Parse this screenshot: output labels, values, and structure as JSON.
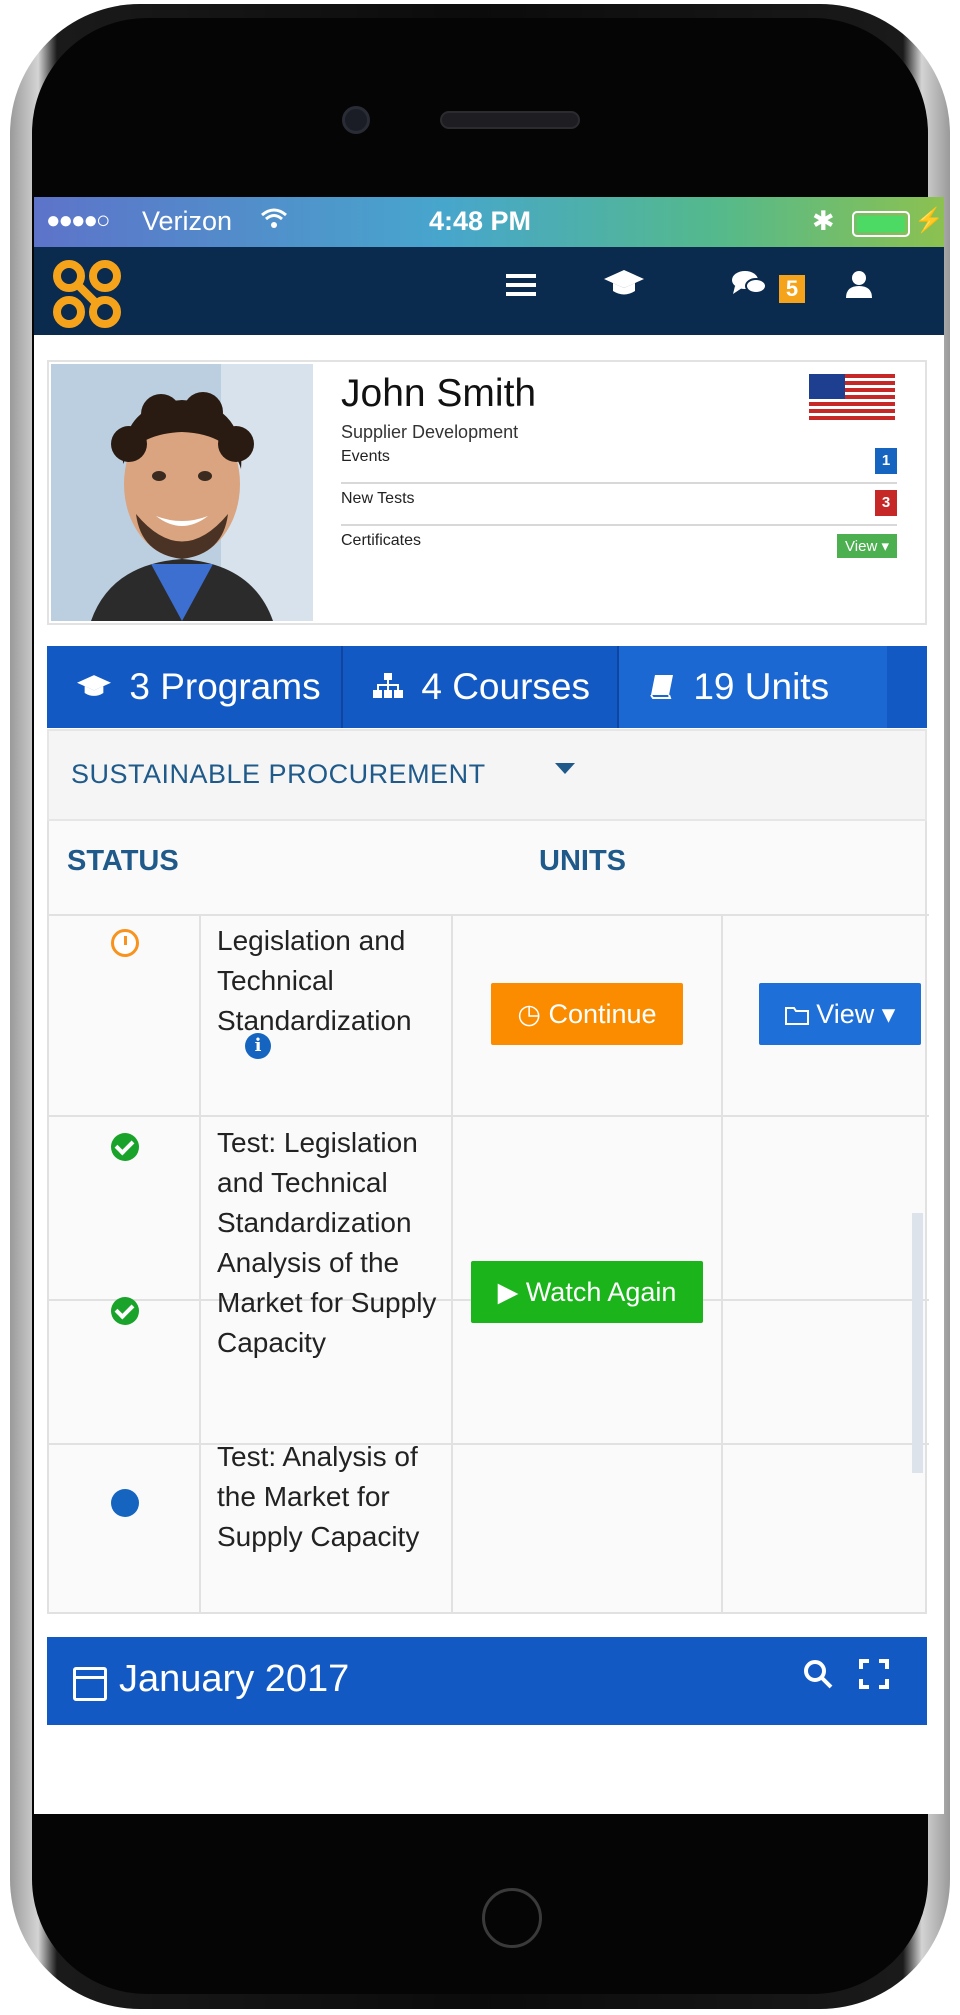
{
  "status_bar": {
    "signal": "●●●●○",
    "carrier": "Verizon",
    "wifi_icon": "wifi-icon",
    "time": "4:48 PM",
    "bluetooth": "✱",
    "charging": "⚡"
  },
  "navbar": {
    "logo_icon": "app-logo",
    "menu_glyph": "☰",
    "programs_glyph": "🎓",
    "chat_glyph": "💬",
    "chat_count": "5",
    "user_glyph": "👤",
    "brand_color": "#f5a31a",
    "bg_color": "#0a2a4e"
  },
  "profile": {
    "name": "John Smith",
    "role": "Supplier Development",
    "flag": "us-flag",
    "stats": [
      {
        "label": "Events",
        "count": "1",
        "color": "#1565c0"
      },
      {
        "label": "New Tests",
        "count": "3",
        "color": "#c62828"
      },
      {
        "label": "Certificates",
        "action": "View ▾",
        "color": "#4caf50"
      }
    ]
  },
  "summary": {
    "programs": {
      "icon": "graduation-cap-icon",
      "label": "3 Programs"
    },
    "courses": {
      "icon": "sitemap-icon",
      "label": "4 Courses"
    },
    "units": {
      "icon": "book-icon",
      "label": "19 Units"
    }
  },
  "course_selector": {
    "selected": "SUSTAINABLE PROCUREMENT"
  },
  "units_table": {
    "headers": {
      "status": "STATUS",
      "units": "UNITS"
    },
    "rows": [
      {
        "status": "in-progress",
        "title": "Legislation and Technical Standardization",
        "has_info": true,
        "action": "Continue",
        "secondary": "View ▾"
      },
      {
        "status": "completed",
        "title": "Test: Legislation and Technical Standardization"
      },
      {
        "status": "completed",
        "title": "Analysis of the Market for Supply Capacity",
        "action": "Watch Again"
      },
      {
        "status": "not-started",
        "title": "Test: Analysis of the Market for Supply Capacity"
      }
    ]
  },
  "calendar": {
    "title": "January 2017",
    "search_glyph": "🔍",
    "expand_glyph": "⤢"
  },
  "colors": {
    "accent": "#1359c4",
    "continue": "#fb8c00",
    "watch_again": "#1bb51b",
    "view": "#1f6fd9"
  }
}
